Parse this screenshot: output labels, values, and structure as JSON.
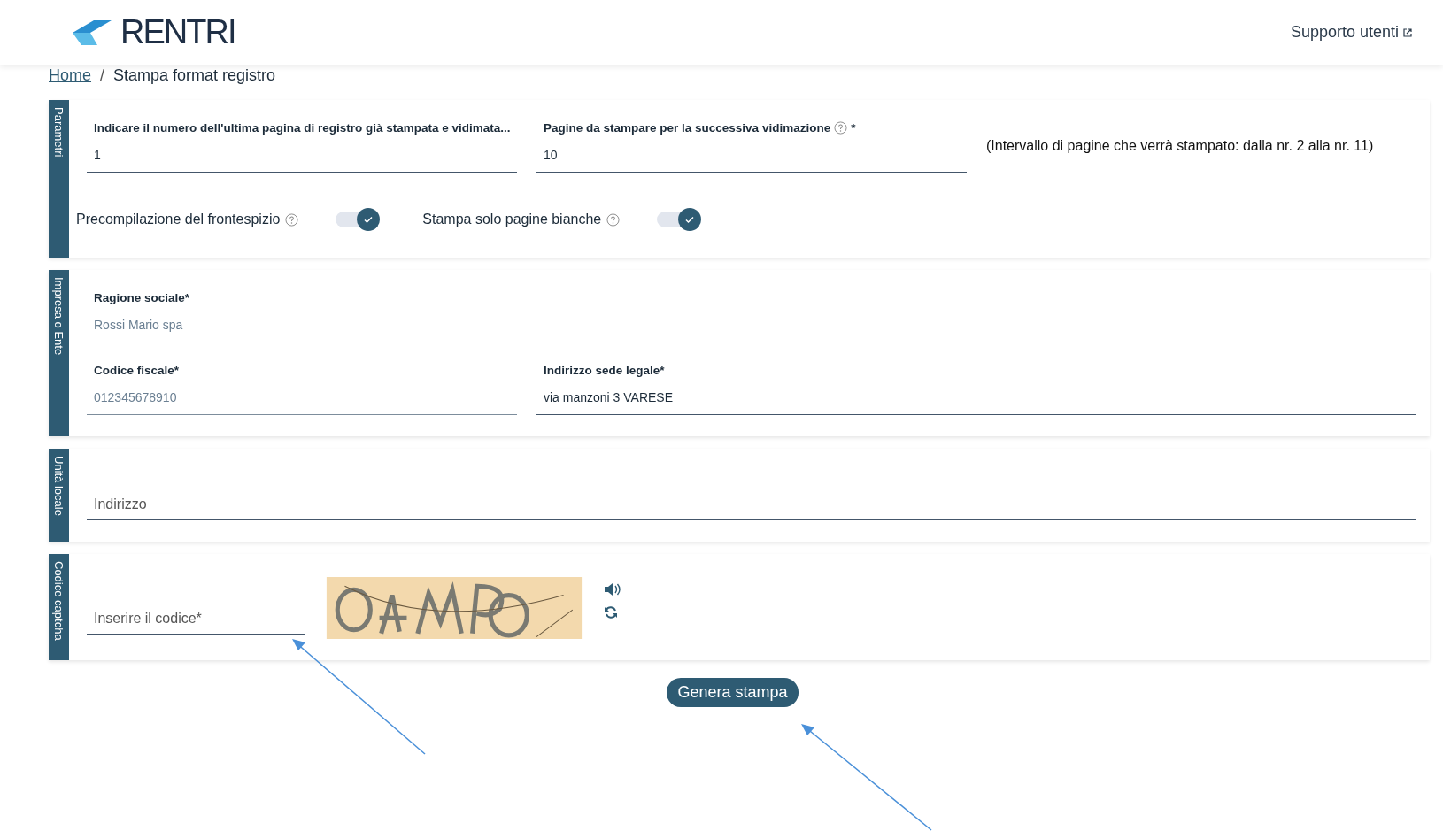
{
  "header": {
    "logo_text": "RENTRI",
    "support_link": "Supporto utenti"
  },
  "breadcrumb": {
    "separator": "/",
    "items": [
      {
        "label": "Home",
        "link": true
      },
      {
        "label": "Stampa format registro",
        "link": false
      }
    ]
  },
  "sections": [
    {
      "title": "Parametri",
      "rows": [
        [
          {
            "kind": "field",
            "label": "Indicare il numero dell'ultima pagina di registro già stampata e vidimata...",
            "help": false,
            "value": "1",
            "readonly": false
          },
          {
            "kind": "field",
            "label": "Pagine da stampare per la successiva vidimazione",
            "help": true,
            "suffix": "*",
            "value": "10",
            "readonly": false
          },
          {
            "kind": "note",
            "text": "(Intervallo di pagine che verrà stampato: dalla nr. 2 alla nr. 11)"
          }
        ],
        [
          {
            "kind": "toggle",
            "label": "Precompilazione del frontespizio",
            "help": true,
            "on": true
          },
          {
            "kind": "toggle",
            "label": "Stampa solo pagine bianche",
            "help": true,
            "on": true
          }
        ]
      ]
    },
    {
      "title": "Impresa o Ente",
      "rows": [
        [
          {
            "kind": "field",
            "label": "Ragione sociale*",
            "help": false,
            "value": "Rossi Mario spa",
            "readonly": true
          }
        ],
        [
          {
            "kind": "field",
            "label": "Codice fiscale*",
            "help": false,
            "value": "012345678910",
            "readonly": true
          },
          {
            "kind": "field",
            "label": "Indirizzo sede legale*",
            "help": false,
            "value": "via manzoni 3 VARESE",
            "readonly": false
          }
        ]
      ]
    },
    {
      "title": "Unità locale",
      "rows": [
        [
          {
            "kind": "field",
            "placeholder": "Indirizzo"
          }
        ]
      ]
    },
    {
      "title": "Codice captcha",
      "rows": [
        [
          {
            "kind": "captcha",
            "placeholder": "Inserire il codice*"
          }
        ]
      ]
    }
  ],
  "submit_button": "Genera stampa"
}
